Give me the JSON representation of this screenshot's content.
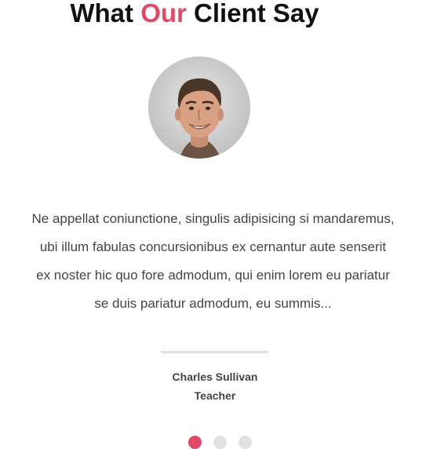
{
  "section": {
    "title_part1": "What ",
    "title_accent": "Our",
    "title_part2": " Client Say"
  },
  "colors": {
    "accent": "#e04a68",
    "text": "#444444",
    "dot_inactive": "#e2e2e2",
    "divider": "#e0e0e0"
  },
  "testimonial": {
    "quote_lines": [
      "Ne appellat coniunctione, singulis adipisicing si mandaremus,",
      "ubi illum fabulas concursionibus ex cernantur aute senserit",
      "ex noster hic quo fore admodum, qui enim lorem eu pariatur",
      "se duis pariatur admodum, eu summis..."
    ],
    "client_name": "Charles Sullivan",
    "client_role": "Teacher"
  },
  "carousel": {
    "total_slides": 3,
    "active_index": 0
  }
}
